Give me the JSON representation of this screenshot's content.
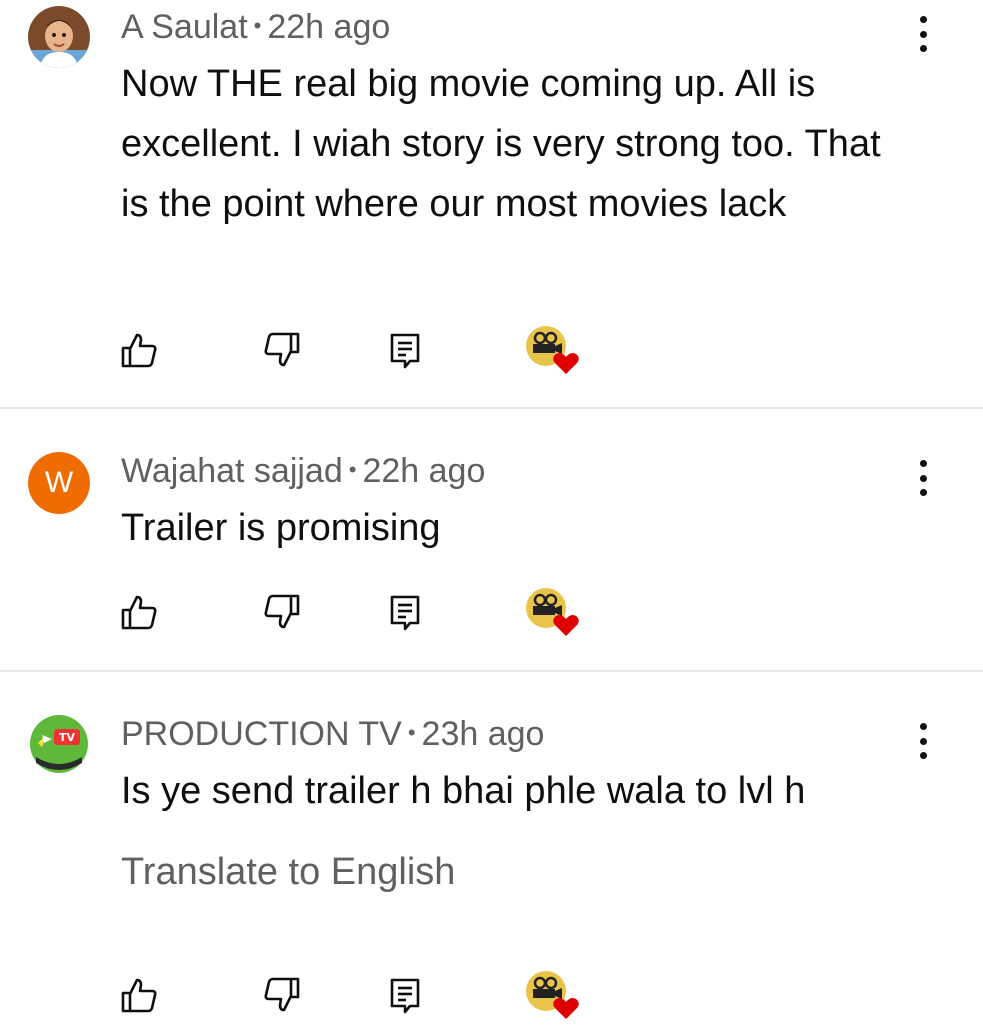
{
  "comments": [
    {
      "author": "A Saulat",
      "time": "22h ago",
      "text": "Now THE real big movie coming up. All is excellent. I wiah story is very strong too. That is the point where our most movies lack",
      "avatar_type": "photo"
    },
    {
      "author": "Wajahat sajjad",
      "time": "22h ago",
      "text": "Trailer is promising",
      "avatar_type": "letter",
      "avatar_letter": "W",
      "avatar_color": "#ef6c00"
    },
    {
      "author": "PRODUCTION TV",
      "time": "23h ago",
      "text": "Is ye send trailer h bhai phle wala to lvl h",
      "avatar_type": "logo",
      "avatar_logo_text": "TV",
      "translate_label": "Translate to English"
    }
  ],
  "separator": "•",
  "icons": {
    "like": "thumbs-up-icon",
    "dislike": "thumbs-down-icon",
    "reply": "reply-icon",
    "creator_heart": "creator-heart-badge"
  },
  "colors": {
    "heart": "#e00000",
    "secondary_text": "#606060",
    "divider": "#e8e8e8"
  }
}
